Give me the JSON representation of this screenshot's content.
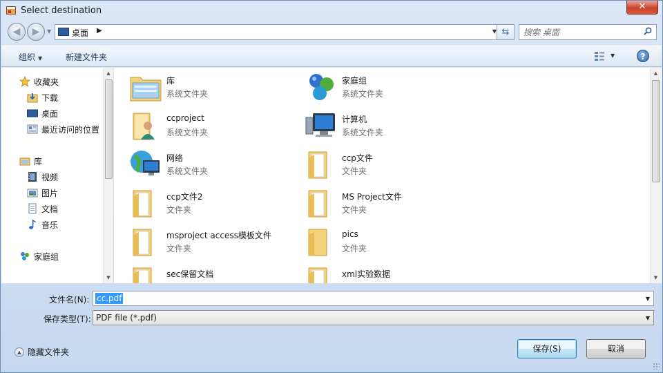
{
  "window": {
    "title": "Select destination",
    "close_label": "✕"
  },
  "nav": {
    "back_glyph": "◀",
    "forward_glyph": "▶",
    "address_path": "桌面",
    "address_chevron": "▶",
    "search_placeholder": "搜索 桌面"
  },
  "toolbar": {
    "organize": "组织",
    "new_folder": "新建文件夹",
    "help": "?"
  },
  "sidebar": {
    "favorites_label": "收藏夹",
    "favorites": [
      "下载",
      "桌面",
      "最近访问的位置"
    ],
    "libraries_label": "库",
    "libraries": [
      "视频",
      "图片",
      "文档",
      "音乐"
    ],
    "homegroup_label": "家庭组"
  },
  "items": [
    {
      "name": "库",
      "type": "系统文件夹",
      "icon": "library-icon"
    },
    {
      "name": "家庭组",
      "type": "系统文件夹",
      "icon": "homegroup-icon"
    },
    {
      "name": "ccproject",
      "type": "系统文件夹",
      "icon": "user-folder-icon"
    },
    {
      "name": "计算机",
      "type": "系统文件夹",
      "icon": "computer-icon"
    },
    {
      "name": "网络",
      "type": "系统文件夹",
      "icon": "network-icon"
    },
    {
      "name": "ccp文件",
      "type": "文件夹",
      "icon": "folder-icon"
    },
    {
      "name": "ccp文件2",
      "type": "文件夹",
      "icon": "folder-icon"
    },
    {
      "name": "MS Project文件",
      "type": "文件夹",
      "icon": "folder-icon"
    },
    {
      "name": "msproject access模板文件",
      "type": "文件夹",
      "icon": "folder-icon"
    },
    {
      "name": "pics",
      "type": "文件夹",
      "icon": "folder-icon"
    },
    {
      "name": "sec保留文档",
      "type": "",
      "icon": "folder-icon"
    },
    {
      "name": "xml实验数据",
      "type": "",
      "icon": "folder-icon"
    }
  ],
  "form": {
    "filename_label": "文件名(N):",
    "filename_value": "cc.pdf",
    "filetype_label": "保存类型(T):",
    "filetype_value": "PDF file (*.pdf)"
  },
  "footer": {
    "hide_folders": "隐藏文件夹",
    "save": "保存(S)",
    "cancel": "取消"
  },
  "colors": {
    "selection": "#3399ff",
    "folder": "#f3d27a",
    "window_frame": "#c7d9f0"
  }
}
